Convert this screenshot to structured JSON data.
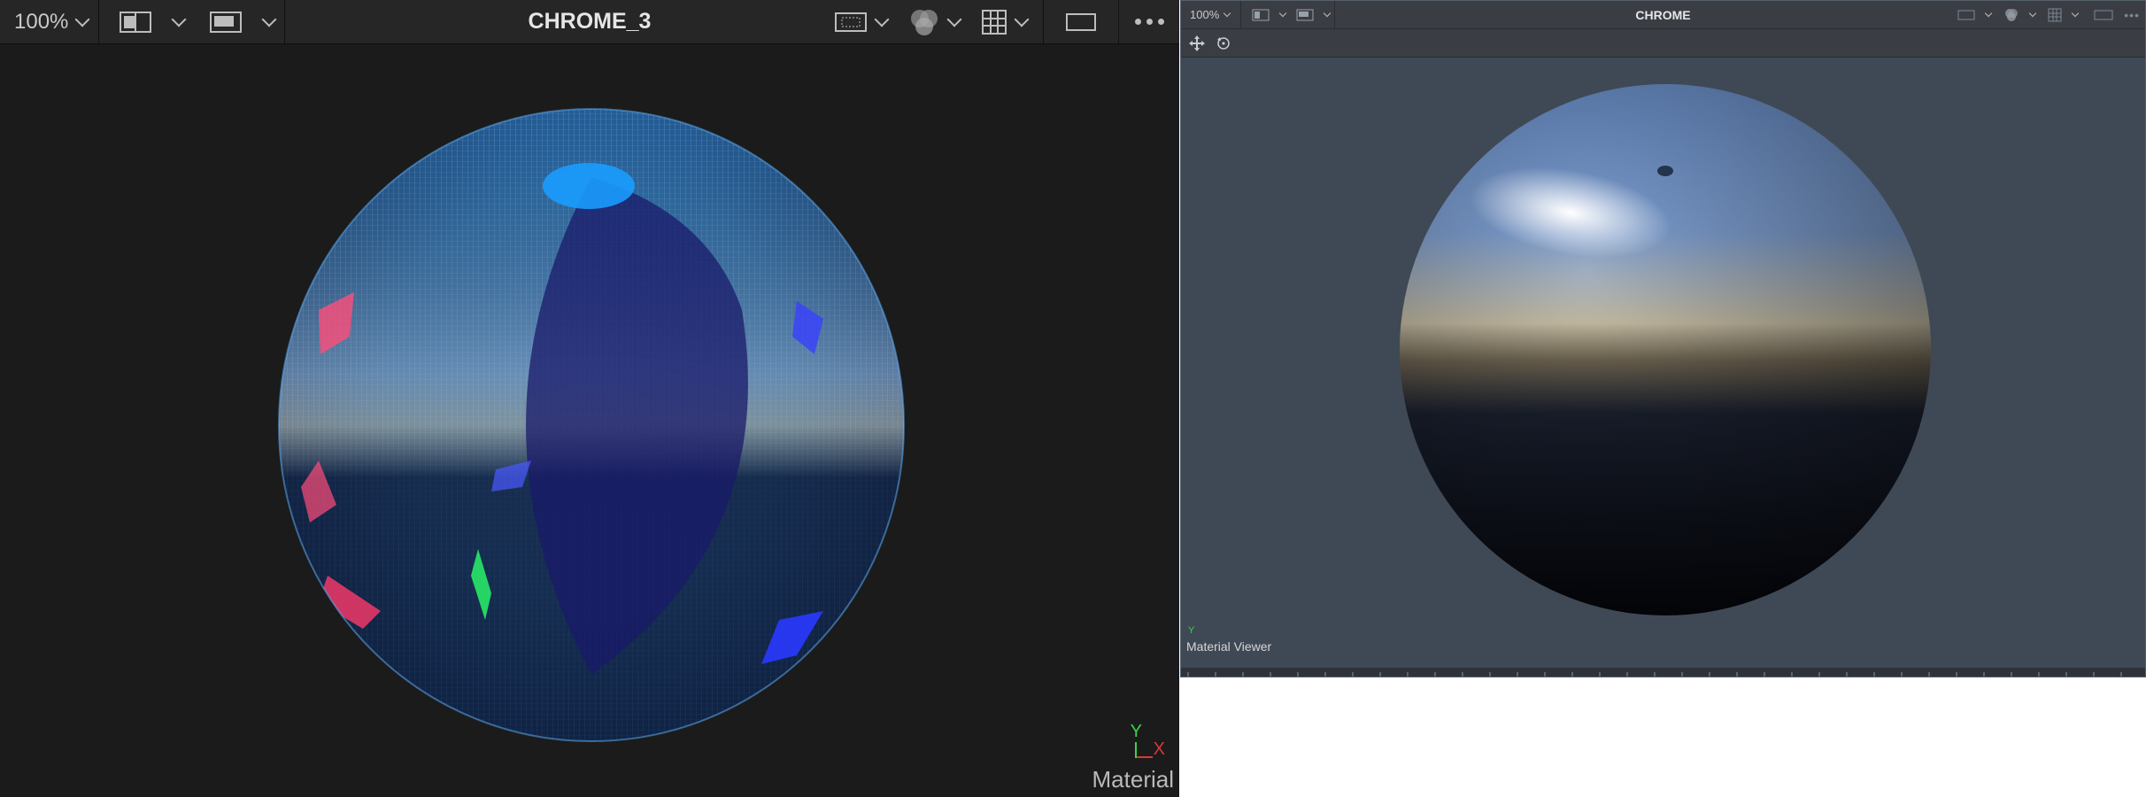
{
  "viewer_left": {
    "zoom": "100%",
    "title": "CHROME_3",
    "overlay_label": "Material",
    "axis_y": "Y",
    "axis_x": "X",
    "icons": [
      "split-view-icon",
      "chevron-down-icon",
      "single-view-icon",
      "chevron-down-icon",
      "roi-icon",
      "chevron-down-icon",
      "color-channels-icon",
      "chevron-down-icon",
      "grid-icon",
      "chevron-down-icon",
      "frame-icon",
      "more-icon"
    ]
  },
  "viewer_right": {
    "zoom": "100%",
    "title": "CHROME",
    "overlay_label": "Material Viewer",
    "axis_y": "Y",
    "icons": [
      "move-icon",
      "rotate-icon"
    ]
  },
  "colors": {
    "left_bg": "#1b1b1b",
    "right_bg": "#3f4955",
    "toolbar": "#262626"
  }
}
